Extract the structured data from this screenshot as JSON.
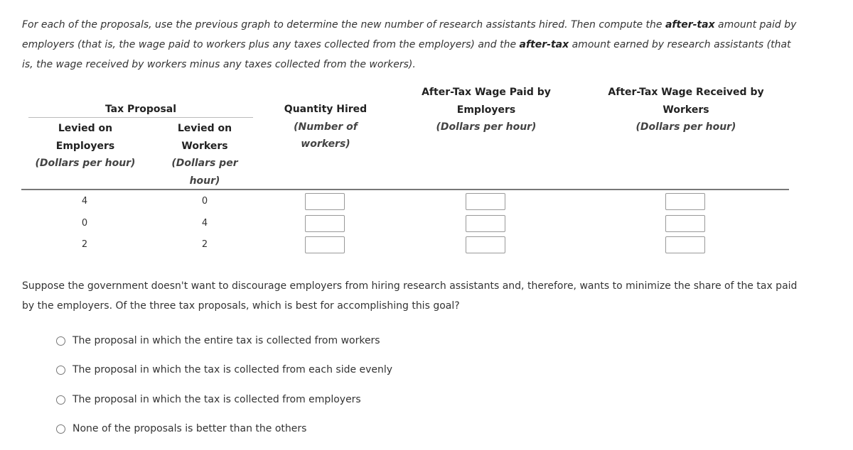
{
  "intro": {
    "part1": "For each of the proposals, use the previous graph to determine the new number of research assistants hired. Then compute the ",
    "bold1": "after-tax",
    "part2": " amount paid by employers (that is, the wage paid to workers plus any taxes collected from the employers) and the ",
    "bold2": "after-tax",
    "part3": " amount earned by research assistants (that is, the wage received by workers minus any taxes collected from the workers)."
  },
  "table": {
    "group_header": "Tax Proposal",
    "columns": [
      {
        "title_line1": "Levied on",
        "title_line2": "Employers",
        "unit": "(Dollars per hour)"
      },
      {
        "title_line1": "Levied on",
        "title_line2": "Workers",
        "unit_line1": "(Dollars per",
        "unit_line2": "hour)"
      },
      {
        "title": "Quantity Hired",
        "unit_line1": "(Number of",
        "unit_line2": "workers)"
      },
      {
        "title_line1": "After-Tax Wage Paid by",
        "title_line2": "Employers",
        "unit": "(Dollars per hour)"
      },
      {
        "title_line1": "After-Tax Wage Received by",
        "title_line2": "Workers",
        "unit": "(Dollars per hour)"
      }
    ],
    "rows": [
      {
        "employers_tax": "4",
        "workers_tax": "0",
        "quantity": "",
        "wage_paid": "",
        "wage_received": ""
      },
      {
        "employers_tax": "0",
        "workers_tax": "4",
        "quantity": "",
        "wage_paid": "",
        "wage_received": ""
      },
      {
        "employers_tax": "2",
        "workers_tax": "2",
        "quantity": "",
        "wage_paid": "",
        "wage_received": ""
      }
    ]
  },
  "question": {
    "text": "Suppose the government doesn't want to discourage employers from hiring research assistants and, therefore, wants to minimize the share of the tax paid by the employers. Of the three tax proposals, which is best for accomplishing this goal?",
    "options": [
      "The proposal in which the entire tax is collected from workers",
      "The proposal in which the tax is collected from each side evenly",
      "The proposal in which the tax is collected from employers",
      "None of the proposals is better than the others"
    ]
  }
}
